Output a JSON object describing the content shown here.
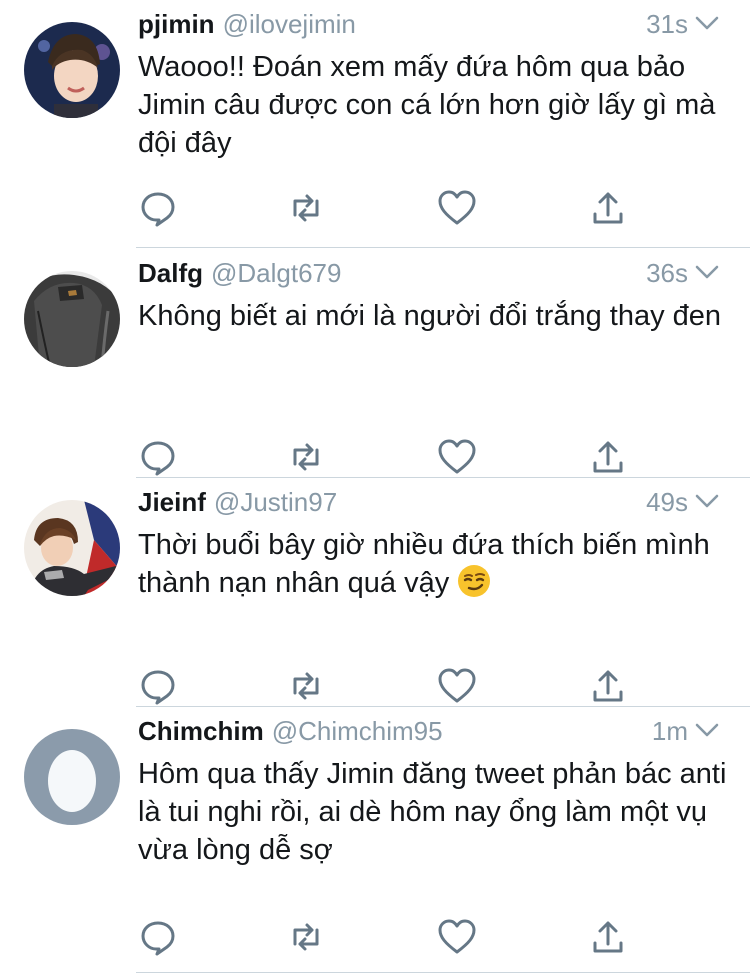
{
  "tweets": [
    {
      "name": "pjimin",
      "handle": "@ilovejimin",
      "time": "31s",
      "text": "Waooo!! Đoán xem mấy đứa hôm qua bảo Jimin câu được con cá lớn hơn giờ lấy gì mà đội đây",
      "avatar": "photo-avatar"
    },
    {
      "name": "Dalfg",
      "handle": "@Dalgt679",
      "time": "36s",
      "text": "Không biết ai mới là người đổi trắng thay đen",
      "avatar": "photo-avatar"
    },
    {
      "name": "Jieinf",
      "handle": "@Justin97",
      "time": "49s",
      "text": "Thời buổi bây giờ nhiều đứa thích biến mình thành nạn nhân quá vậy",
      "emoji": "smirk-emoji",
      "avatar": "photo-avatar"
    },
    {
      "name": "Chimchim",
      "handle": "@Chimchim95",
      "time": "1m",
      "text": "Hôm qua thấy Jimin đăng tweet phản bác anti là tui nghi rồi, ai dè hôm nay ổng làm một vụ vừa lòng dễ sợ",
      "avatar": "default-egg-avatar"
    }
  ],
  "icons": {
    "reply": "reply-icon",
    "retweet": "retweet-icon",
    "like": "heart-icon",
    "share": "share-icon",
    "menu": "chevron-down-icon"
  },
  "colors": {
    "text": "#14171a",
    "secondary": "#8899a6",
    "icon": "#657786",
    "divider": "#ccd6dd",
    "egg_bg": "#8b9bab"
  }
}
